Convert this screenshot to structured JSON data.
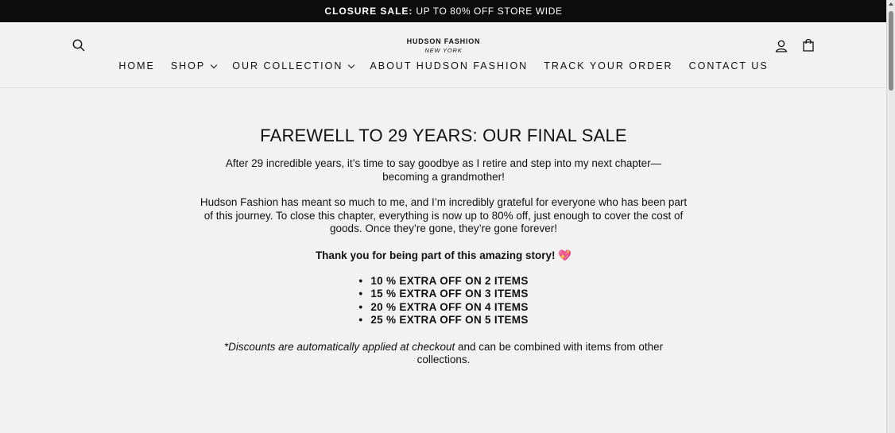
{
  "announcement": {
    "bold": "CLOSURE SALE:",
    "rest": "UP TO 80% OFF STORE WIDE"
  },
  "header": {
    "logo_name": "HUDSON FASHION",
    "logo_sub": "NEW YORK",
    "icons": {
      "search": "search-icon",
      "account": "user-icon",
      "cart": "bag-icon"
    }
  },
  "nav": {
    "home": "HOME",
    "shop": "SHOP",
    "collection": "OUR COLLECTION",
    "about": "ABOUT HUDSON FASHION",
    "track": "TRACK YOUR ORDER",
    "contact": "CONTACT US"
  },
  "main": {
    "title": "FAREWELL TO 29 YEARS: OUR FINAL SALE",
    "paragraph1": "After 29 incredible years, it’s time to say goodbye as I retire and step into my next chapter—becoming a grandmother!",
    "paragraph2": "Hudson Fashion has meant so much to me, and I’m incredibly grateful for everyone who has been part of this journey. To close this chapter, everything is now up to 80% off, just enough to cover the cost of goods. Once they’re gone, they’re gone forever!",
    "thanks": "Thank you for being part of this amazing story!",
    "heart": "💖",
    "offers": [
      "10 % EXTRA OFF ON 2 ITEMS",
      "15 % EXTRA OFF ON 3 ITEMS",
      "20 % EXTRA OFF ON 4 ITEMS",
      "25 % EXTRA OFF ON 5 ITEMS"
    ],
    "discount_italic": "*Discounts are automatically applied at checkout",
    "discount_rest": " and can be combined with items from other collections."
  },
  "colors": {
    "announcement_bg": "#0c0c0c",
    "page_bg": "#f2f2f2",
    "heart": "#e2395a"
  }
}
